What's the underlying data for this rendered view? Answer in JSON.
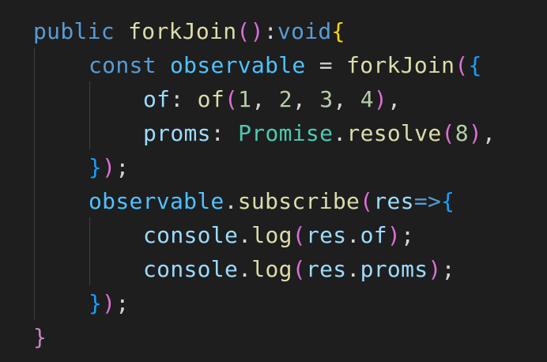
{
  "editor": {
    "language": "typescript",
    "theme_background": "#1e1e1e",
    "lines": [
      "public forkJoin():void{",
      "    const observable = forkJoin({",
      "        of: of(1, 2, 3, 4),",
      "        proms: Promise.resolve(8),",
      "    });",
      "    observable.subscribe(res=>{",
      "        console.log(res.of);",
      "        console.log(res.proms);",
      "    });",
      "}"
    ]
  },
  "tokens": {
    "l1": {
      "public": "public",
      "name": "forkJoin",
      "paren_open": "(",
      "paren_close": ")",
      "colon": ":",
      "void": "void",
      "brace": "{"
    },
    "l2": {
      "const": "const",
      "var": "observable",
      "eq": "=",
      "fn": "forkJoin",
      "paren": "(",
      "brace": "{"
    },
    "l3": {
      "key": "of",
      "colon": ":",
      "fn": "of",
      "paren_open": "(",
      "n1": "1",
      "c1": ",",
      "n2": "2",
      "c2": ",",
      "n3": "3",
      "c3": ",",
      "n4": "4",
      "paren_close": ")",
      "comma": ","
    },
    "l4": {
      "key": "proms",
      "colon": ":",
      "cls": "Promise",
      "dot": ".",
      "fn": "resolve",
      "paren_open": "(",
      "num": "8",
      "paren_close": ")",
      "comma": ","
    },
    "l5": {
      "brace": "}",
      "paren": ")",
      "semi": ";"
    },
    "l6": {
      "var": "observable",
      "dot": ".",
      "fn": "subscribe",
      "paren": "(",
      "param": "res",
      "arrow": "=>",
      "brace": "{"
    },
    "l7": {
      "obj": "console",
      "dot": ".",
      "fn": "log",
      "paren_open": "(",
      "arg": "res",
      "dot2": ".",
      "prop": "of",
      "paren_close": ")",
      "semi": ";"
    },
    "l8": {
      "obj": "console",
      "dot": ".",
      "fn": "log",
      "paren_open": "(",
      "arg": "res",
      "dot2": ".",
      "prop": "proms",
      "paren_close": ")",
      "semi": ";"
    },
    "l9": {
      "brace": "}",
      "paren": ")",
      "semi": ";"
    },
    "l10": {
      "brace": "}"
    }
  }
}
